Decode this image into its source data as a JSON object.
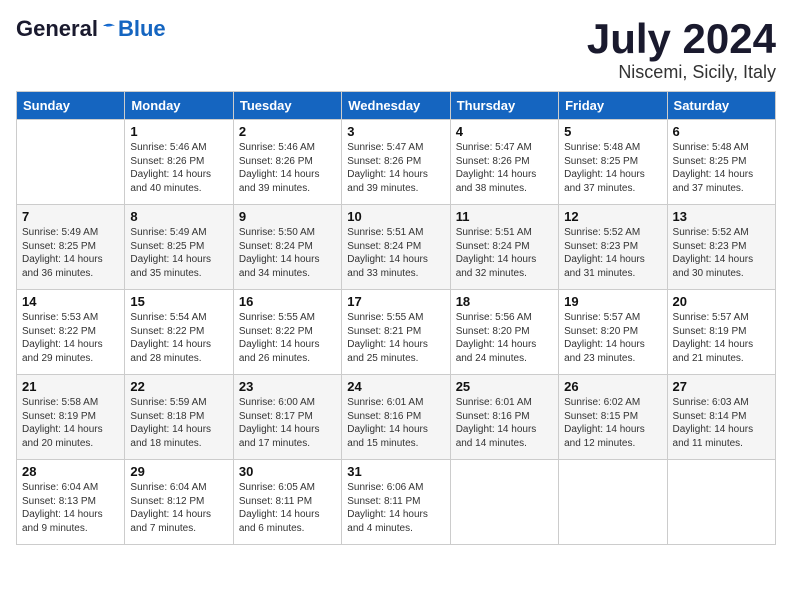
{
  "header": {
    "logo": {
      "general": "General",
      "blue": "Blue"
    },
    "title": "July 2024",
    "location": "Niscemi, Sicily, Italy"
  },
  "days_of_week": [
    "Sunday",
    "Monday",
    "Tuesday",
    "Wednesday",
    "Thursday",
    "Friday",
    "Saturday"
  ],
  "weeks": [
    [
      null,
      {
        "day": 1,
        "sunrise": "5:46 AM",
        "sunset": "8:26 PM",
        "daylight": "14 hours and 40 minutes."
      },
      {
        "day": 2,
        "sunrise": "5:46 AM",
        "sunset": "8:26 PM",
        "daylight": "14 hours and 39 minutes."
      },
      {
        "day": 3,
        "sunrise": "5:47 AM",
        "sunset": "8:26 PM",
        "daylight": "14 hours and 39 minutes."
      },
      {
        "day": 4,
        "sunrise": "5:47 AM",
        "sunset": "8:26 PM",
        "daylight": "14 hours and 38 minutes."
      },
      {
        "day": 5,
        "sunrise": "5:48 AM",
        "sunset": "8:25 PM",
        "daylight": "14 hours and 37 minutes."
      },
      {
        "day": 6,
        "sunrise": "5:48 AM",
        "sunset": "8:25 PM",
        "daylight": "14 hours and 37 minutes."
      }
    ],
    [
      {
        "day": 7,
        "sunrise": "5:49 AM",
        "sunset": "8:25 PM",
        "daylight": "14 hours and 36 minutes."
      },
      {
        "day": 8,
        "sunrise": "5:49 AM",
        "sunset": "8:25 PM",
        "daylight": "14 hours and 35 minutes."
      },
      {
        "day": 9,
        "sunrise": "5:50 AM",
        "sunset": "8:24 PM",
        "daylight": "14 hours and 34 minutes."
      },
      {
        "day": 10,
        "sunrise": "5:51 AM",
        "sunset": "8:24 PM",
        "daylight": "14 hours and 33 minutes."
      },
      {
        "day": 11,
        "sunrise": "5:51 AM",
        "sunset": "8:24 PM",
        "daylight": "14 hours and 32 minutes."
      },
      {
        "day": 12,
        "sunrise": "5:52 AM",
        "sunset": "8:23 PM",
        "daylight": "14 hours and 31 minutes."
      },
      {
        "day": 13,
        "sunrise": "5:52 AM",
        "sunset": "8:23 PM",
        "daylight": "14 hours and 30 minutes."
      }
    ],
    [
      {
        "day": 14,
        "sunrise": "5:53 AM",
        "sunset": "8:22 PM",
        "daylight": "14 hours and 29 minutes."
      },
      {
        "day": 15,
        "sunrise": "5:54 AM",
        "sunset": "8:22 PM",
        "daylight": "14 hours and 28 minutes."
      },
      {
        "day": 16,
        "sunrise": "5:55 AM",
        "sunset": "8:22 PM",
        "daylight": "14 hours and 26 minutes."
      },
      {
        "day": 17,
        "sunrise": "5:55 AM",
        "sunset": "8:21 PM",
        "daylight": "14 hours and 25 minutes."
      },
      {
        "day": 18,
        "sunrise": "5:56 AM",
        "sunset": "8:20 PM",
        "daylight": "14 hours and 24 minutes."
      },
      {
        "day": 19,
        "sunrise": "5:57 AM",
        "sunset": "8:20 PM",
        "daylight": "14 hours and 23 minutes."
      },
      {
        "day": 20,
        "sunrise": "5:57 AM",
        "sunset": "8:19 PM",
        "daylight": "14 hours and 21 minutes."
      }
    ],
    [
      {
        "day": 21,
        "sunrise": "5:58 AM",
        "sunset": "8:19 PM",
        "daylight": "14 hours and 20 minutes."
      },
      {
        "day": 22,
        "sunrise": "5:59 AM",
        "sunset": "8:18 PM",
        "daylight": "14 hours and 18 minutes."
      },
      {
        "day": 23,
        "sunrise": "6:00 AM",
        "sunset": "8:17 PM",
        "daylight": "14 hours and 17 minutes."
      },
      {
        "day": 24,
        "sunrise": "6:01 AM",
        "sunset": "8:16 PM",
        "daylight": "14 hours and 15 minutes."
      },
      {
        "day": 25,
        "sunrise": "6:01 AM",
        "sunset": "8:16 PM",
        "daylight": "14 hours and 14 minutes."
      },
      {
        "day": 26,
        "sunrise": "6:02 AM",
        "sunset": "8:15 PM",
        "daylight": "14 hours and 12 minutes."
      },
      {
        "day": 27,
        "sunrise": "6:03 AM",
        "sunset": "8:14 PM",
        "daylight": "14 hours and 11 minutes."
      }
    ],
    [
      {
        "day": 28,
        "sunrise": "6:04 AM",
        "sunset": "8:13 PM",
        "daylight": "14 hours and 9 minutes."
      },
      {
        "day": 29,
        "sunrise": "6:04 AM",
        "sunset": "8:12 PM",
        "daylight": "14 hours and 7 minutes."
      },
      {
        "day": 30,
        "sunrise": "6:05 AM",
        "sunset": "8:11 PM",
        "daylight": "14 hours and 6 minutes."
      },
      {
        "day": 31,
        "sunrise": "6:06 AM",
        "sunset": "8:11 PM",
        "daylight": "14 hours and 4 minutes."
      },
      null,
      null,
      null
    ]
  ]
}
